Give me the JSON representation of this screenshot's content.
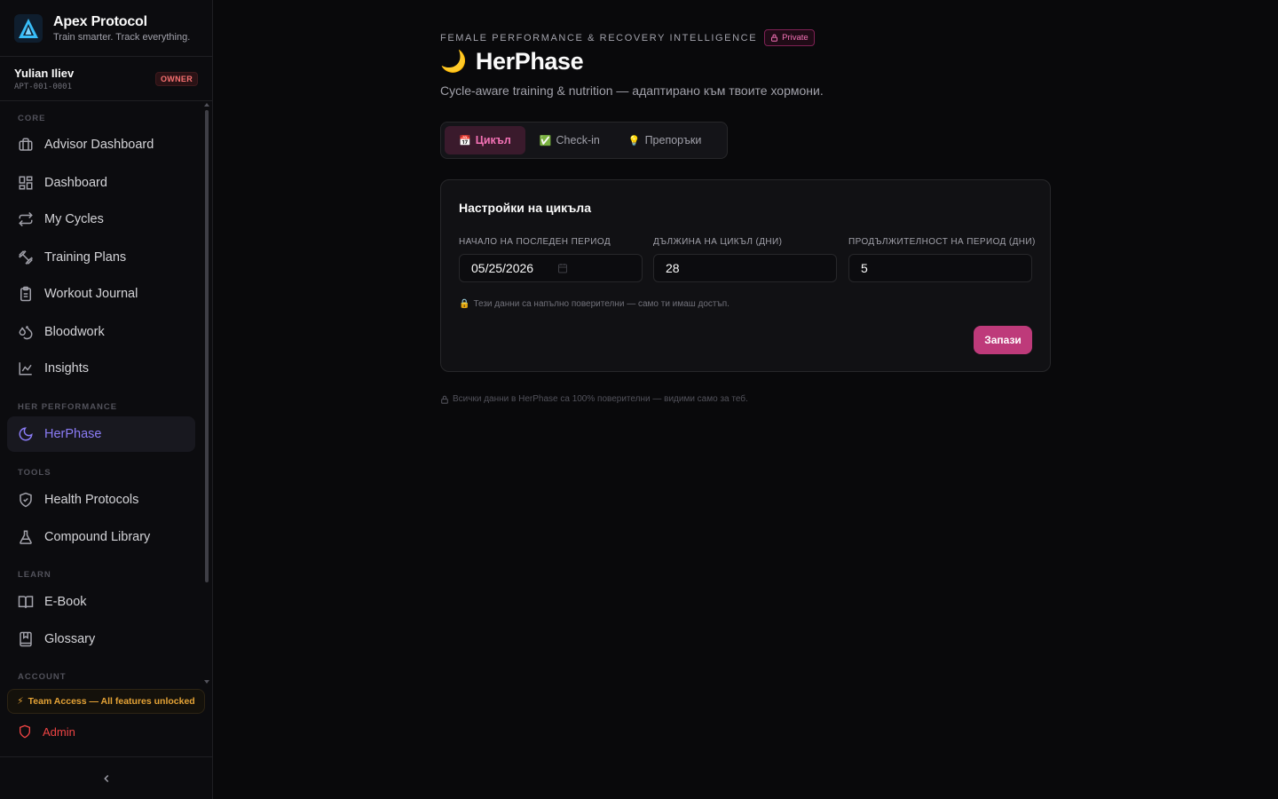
{
  "brand": {
    "title": "Apex Protocol",
    "tagline": "Train smarter. Track everything."
  },
  "user": {
    "name": "Yulian Iliev",
    "id": "APT-001-0001",
    "role": "OWNER"
  },
  "sidebar": {
    "sections": {
      "core": "CORE",
      "her_performance": "HER PERFORMANCE",
      "tools": "TOOLS",
      "learn": "LEARN",
      "account": "ACCOUNT"
    },
    "items": {
      "advisor_dashboard": "Advisor Dashboard",
      "dashboard": "Dashboard",
      "my_cycles": "My Cycles",
      "training_plans": "Training Plans",
      "workout_journal": "Workout Journal",
      "bloodwork": "Bloodwork",
      "insights": "Insights",
      "herphase": "HerPhase",
      "health_protocols": "Health Protocols",
      "compound_library": "Compound Library",
      "ebook": "E-Book",
      "glossary": "Glossary"
    },
    "active_item": "HerPhase",
    "team_access": "Team Access — All features unlocked",
    "admin": "Admin",
    "collapse_icon": "chevron-left"
  },
  "header": {
    "eyebrow": "FEMALE PERFORMANCE & RECOVERY INTELLIGENCE",
    "badge": "Private",
    "title": "HerPhase",
    "title_emoji": "🌙",
    "subtitle": "Cycle-aware training & nutrition — адаптирано към твоите хормони."
  },
  "tabs": [
    {
      "icon": "📅",
      "label": "Цикъл",
      "active": true
    },
    {
      "icon": "✅",
      "label": "Check-in",
      "active": false
    },
    {
      "icon": "💡",
      "label": "Препоръки",
      "active": false
    }
  ],
  "settings": {
    "title": "Настройки на цикъла",
    "fields": {
      "last_period_label": "НАЧАЛО НА ПОСЛЕДЕН ПЕРИОД",
      "last_period_value": "05/25/2026",
      "cycle_length_label": "ДЪЛЖИНА НА ЦИКЪЛ (ДНИ)",
      "cycle_length_value": "28",
      "period_length_label": "ПРОДЪЛЖИТЕЛНОСТ НА ПЕРИОД (ДНИ)",
      "period_length_value": "5"
    },
    "privacy_note": "Тези данни са напълно поверителни — само ти имаш достъп.",
    "save_label": "Запази"
  },
  "footer_note": "Всички данни в HerPhase са 100% поверителни — видими само за теб.",
  "colors": {
    "accent_pink": "#be3a7a",
    "accent_purple": "#8b7cf6",
    "background": "#09090b"
  }
}
